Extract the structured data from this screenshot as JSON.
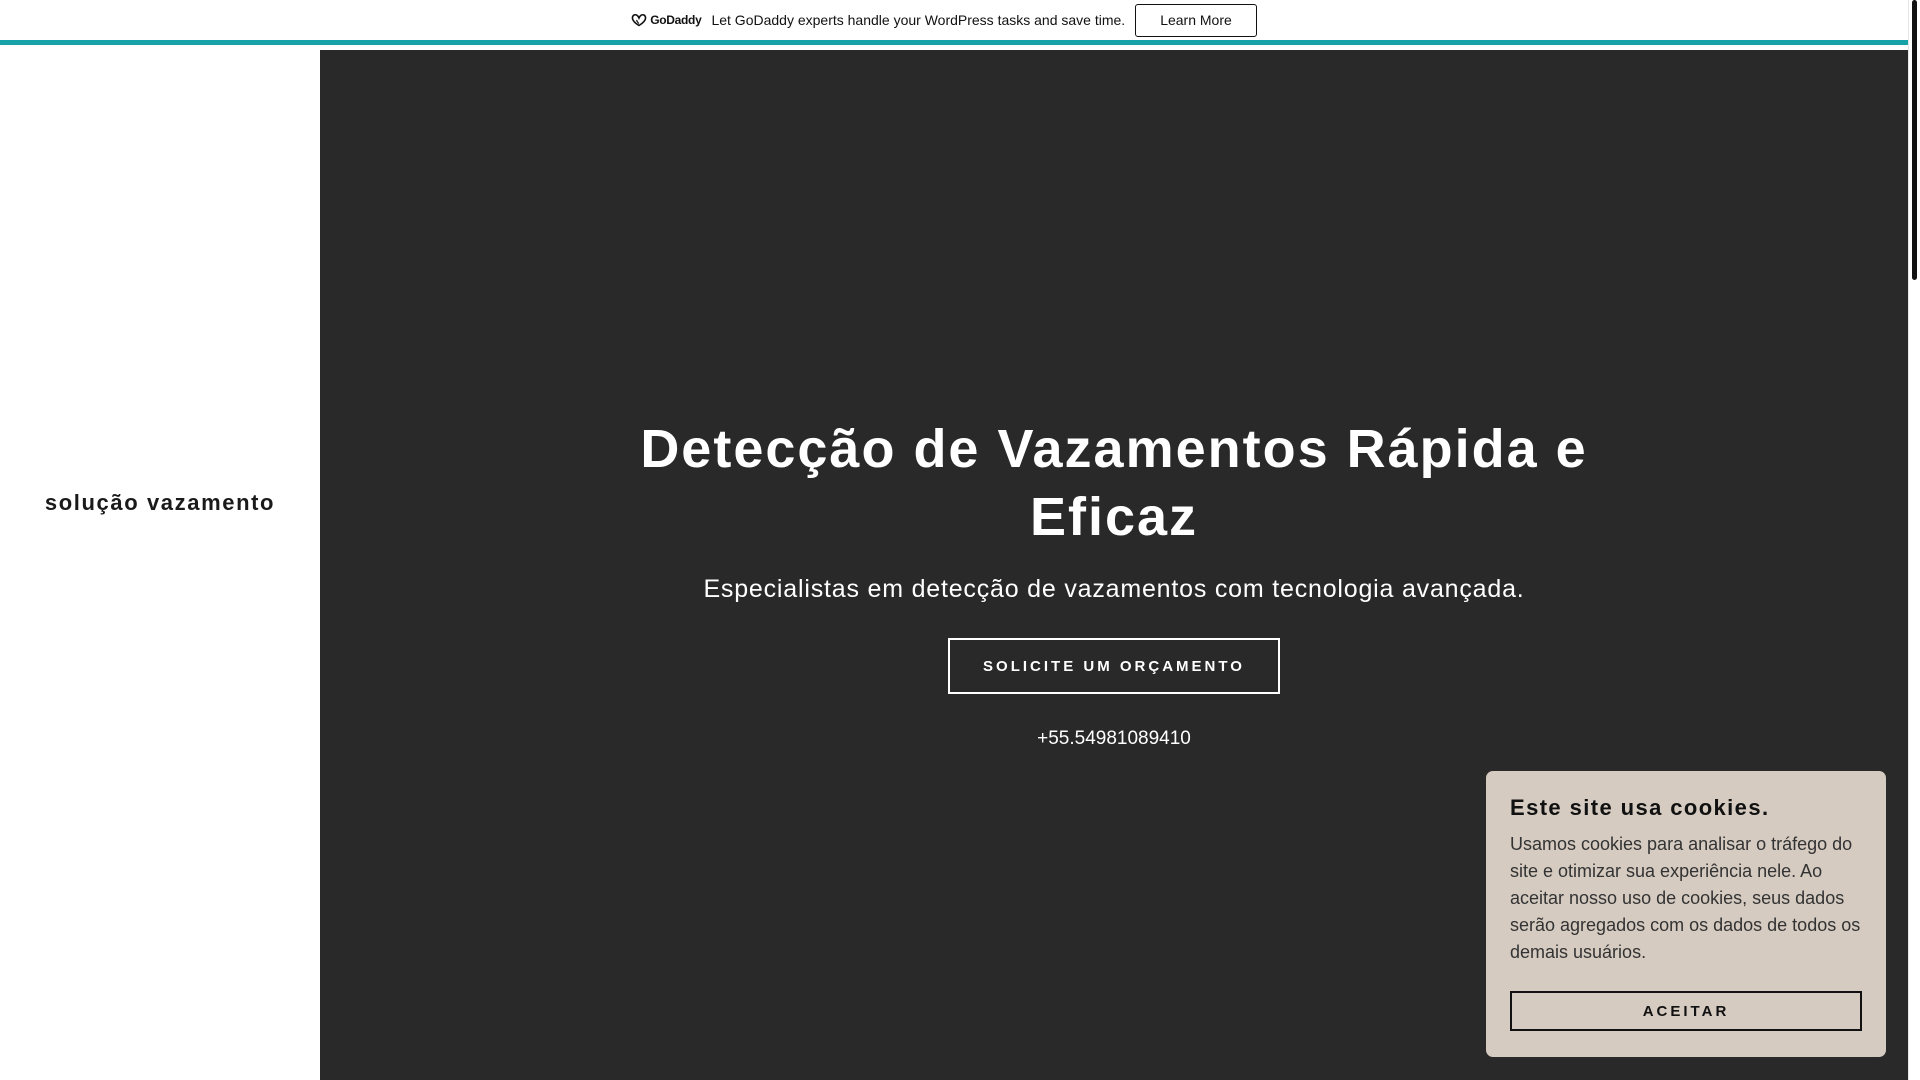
{
  "promo": {
    "logo_text": "GoDaddy",
    "message": "Let GoDaddy experts handle your WordPress tasks and save time.",
    "button_label": "Learn More",
    "accent_color": "#16a2a7"
  },
  "sidebar": {
    "site_title": "solução vazamento"
  },
  "hero": {
    "title": "Detecção de Vazamentos Rápida e Eficaz",
    "subtitle": "Especialistas em detecção de vazamentos com tecnologia avançada.",
    "cta_label": "SOLICITE UM ORÇAMENTO",
    "phone": "+55.54981089410",
    "background_color": "#292929"
  },
  "cookie": {
    "title": "Este site usa cookies.",
    "text": "Usamos cookies para analisar o tráfego do site e otimizar sua experiência nele. Ao aceitar nosso uso de cookies, seus dados serão agregados com os dados de todos os demais usuários.",
    "accept_label": "ACEITAR",
    "background_color": "#d5cbc1"
  }
}
